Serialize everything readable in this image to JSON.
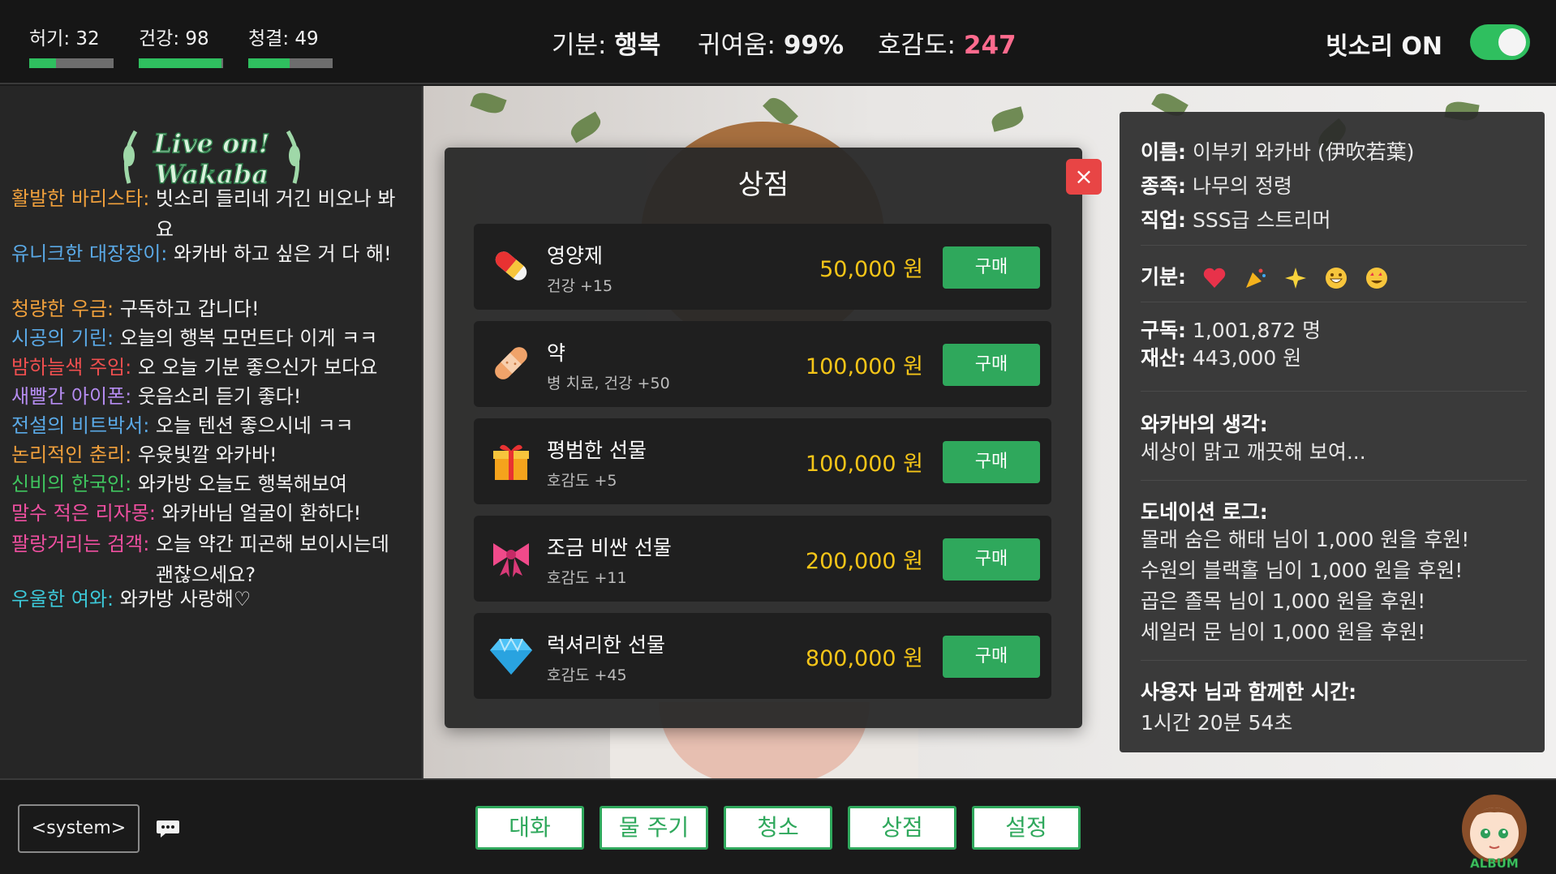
{
  "topbar": {
    "stats": [
      {
        "label": "허기: 32",
        "level": 0.32
      },
      {
        "label": "건강: 98",
        "level": 0.98
      },
      {
        "label": "청결: 49",
        "level": 0.49
      }
    ],
    "mood_label": "기분:",
    "mood_value": "행복",
    "cute_label": "귀여움:",
    "cute_value": "99%",
    "affinity_label": "호감도:",
    "affinity_value": "247",
    "rain_label": "빗소리 ON",
    "rain_on": true
  },
  "chat": {
    "logo_line1": "Live on!",
    "logo_line2": "Wakaba",
    "messages": [
      {
        "nick": "활발한 바리스타:",
        "text": "빗소리 들리네 거긴 비오나 봐요",
        "color": "#f0a03c"
      },
      {
        "nick": "유니크한 대장장이:",
        "text": "와카바 하고 싶은 거 다 해!",
        "color": "#5aa9e6"
      },
      {
        "nick": "청량한 우금:",
        "text": "구독하고 갑니다!",
        "color": "#f0a03c"
      },
      {
        "nick": "시공의 기린:",
        "text": "오늘의 행복 모먼트다 이게 ㅋㅋ",
        "color": "#5aa9e6"
      },
      {
        "nick": "밤하늘색 주임:",
        "text": "오 오늘 기분 좋으신가 보다요",
        "color": "#ef4f4f"
      },
      {
        "nick": "새빨간 아이폰:",
        "text": "웃음소리 듣기 좋다!",
        "color": "#b58cf0"
      },
      {
        "nick": "전설의 비트박서:",
        "text": "오늘 텐션 좋으시네 ㅋㅋ",
        "color": "#5aa9e6"
      },
      {
        "nick": "논리적인 춘리:",
        "text": "우윳빛깔 와카바!",
        "color": "#f0a03c"
      },
      {
        "nick": "신비의 한국인:",
        "text": "와카방 오늘도 행복해보여",
        "color": "#3fc45e"
      },
      {
        "nick": "말수 적은 리자몽:",
        "text": "와카바님 얼굴이 환하다!",
        "color": "#ef4fa0"
      },
      {
        "nick": "팔랑거리는 검객:",
        "text": "오늘 약간 피곤해 보이시는데 괜찮으세요?",
        "color": "#ef4fa0"
      },
      {
        "nick": "우울한 여와:",
        "text": "와카방 사랑해♡",
        "color": "#3cc8d8"
      }
    ]
  },
  "shop": {
    "title": "상점",
    "close": "×",
    "items": [
      {
        "name": "영양제",
        "desc": "건강 +15",
        "price": "50,000 원",
        "buy": "구매",
        "icon": "pill-icon"
      },
      {
        "name": "약",
        "desc": "병 치료, 건강 +50",
        "price": "100,000 원",
        "buy": "구매",
        "icon": "bandage-icon"
      },
      {
        "name": "평범한 선물",
        "desc": "호감도 +5",
        "price": "100,000 원",
        "buy": "구매",
        "icon": "gift-icon"
      },
      {
        "name": "조금 비싼 선물",
        "desc": "호감도 +11",
        "price": "200,000 원",
        "buy": "구매",
        "icon": "ribbon-icon"
      },
      {
        "name": "럭셔리한 선물",
        "desc": "호감도 +45",
        "price": "800,000 원",
        "buy": "구매",
        "icon": "diamond-icon"
      }
    ]
  },
  "info": {
    "name_label": "이름:",
    "name_value": "이부키 와카바 (伊吹若葉)",
    "race_label": "종족:",
    "race_value": "나무의 정령",
    "job_label": "직업:",
    "job_value": "SSS급 스트리머",
    "mood_label": "기분:",
    "mood_icons": [
      "heart-icon",
      "party-popper-icon",
      "sparkles-icon",
      "grin-icon",
      "star-eyes-icon"
    ],
    "subs_label": "구독:",
    "subs_value": "1,001,872 명",
    "money_label": "재산:",
    "money_value": "443,000 원",
    "thought_label": "와카바의 생각:",
    "thought_value": "세상이 맑고 깨끗해 보여...",
    "donation_label": "도네이션 로그:",
    "donations": [
      "몰래 숨은 해태 님이 1,000 원을 후원!",
      "수원의 블랙홀 님이 1,000 원을 후원!",
      "곱은 졸목 님이 1,000 원을 후원!",
      "세일러 문 님이 1,000 원을 후원!"
    ],
    "time_label": "사용자 님과 함께한 시간:",
    "time_value": "1시간 20분 54초"
  },
  "bottom": {
    "system": "<system>",
    "nav": [
      "대화",
      "물 주기",
      "청소",
      "상점",
      "설정"
    ],
    "album": "ALBUM"
  },
  "colors": {
    "accent": "#2fa85c",
    "price": "#f5c518",
    "affinity": "#ff6b8e",
    "close": "#e84545"
  }
}
